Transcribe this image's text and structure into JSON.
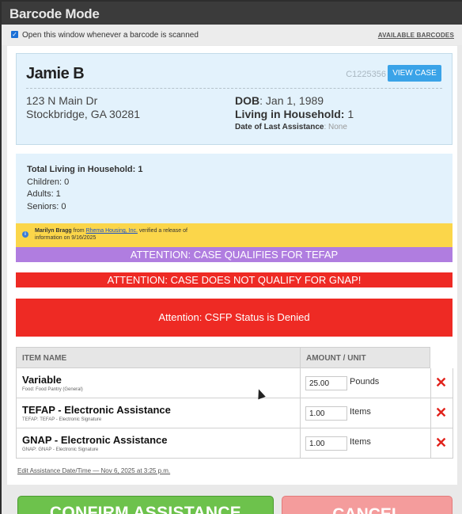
{
  "window": {
    "title": "Barcode Mode"
  },
  "top": {
    "checkbox_label": "Open this window whenever a barcode is scanned",
    "available_link": "AVAILABLE BARCODES"
  },
  "case": {
    "name": "Jamie B",
    "id": "C1225356",
    "view_button": "VIEW CASE",
    "address_line1": "123 N Main Dr",
    "address_line2": "Stockbridge, GA  30281",
    "dob_label": "DOB",
    "dob_value": ": Jan 1, 1989",
    "living_label": "Living in Household:",
    "living_value": " 1",
    "last_assist_label": "Date of Last Assistance",
    "last_assist_value": ": None"
  },
  "household": {
    "total": "Total Living in Household: 1",
    "children": "Children: 0",
    "adults": "Adults: 1",
    "seniors": "Seniors: 0"
  },
  "notice": {
    "person": "Marilyn Bragg",
    "from": " from ",
    "org": "Rhema Housing, Inc.",
    "rest": " verified a release of",
    "line2": "information on 9/16/2025"
  },
  "alerts": {
    "tefap": "ATTENTION: CASE QUALIFIES FOR TEFAP",
    "gnap": "ATTENTION: CASE DOES NOT QUALIFY FOR GNAP!",
    "csfp": "Attention: CSFP Status is Denied"
  },
  "table": {
    "col_item": "ITEM NAME",
    "col_amount": "AMOUNT / UNIT",
    "rows": [
      {
        "name": "Variable",
        "sub": "Food: Food Pantry (General)",
        "amount": "25.00",
        "unit": "Pounds"
      },
      {
        "name": "TEFAP - Electronic Assistance",
        "sub": "TEFAP: TEFAP - Electronic Signature",
        "amount": "1.00",
        "unit": "Items"
      },
      {
        "name": "GNAP - Electronic Assistance",
        "sub": "GNAP: GNAP - Electronic Signature",
        "amount": "1.00",
        "unit": "Items"
      }
    ]
  },
  "edit": {
    "link": "Edit Assistance Date/Time",
    "value": " — Nov 6, 2025 at 3:25 p.m."
  },
  "buttons": {
    "confirm": "CONFIRM ASSISTANCE",
    "cancel": "CANCEL"
  },
  "colors": {
    "tefap": "#b07de0",
    "alert_red": "#ee2a24",
    "confirm_green": "#6dc24c",
    "cancel_pink": "#f49c9c",
    "view_blue": "#3aa3e8"
  }
}
